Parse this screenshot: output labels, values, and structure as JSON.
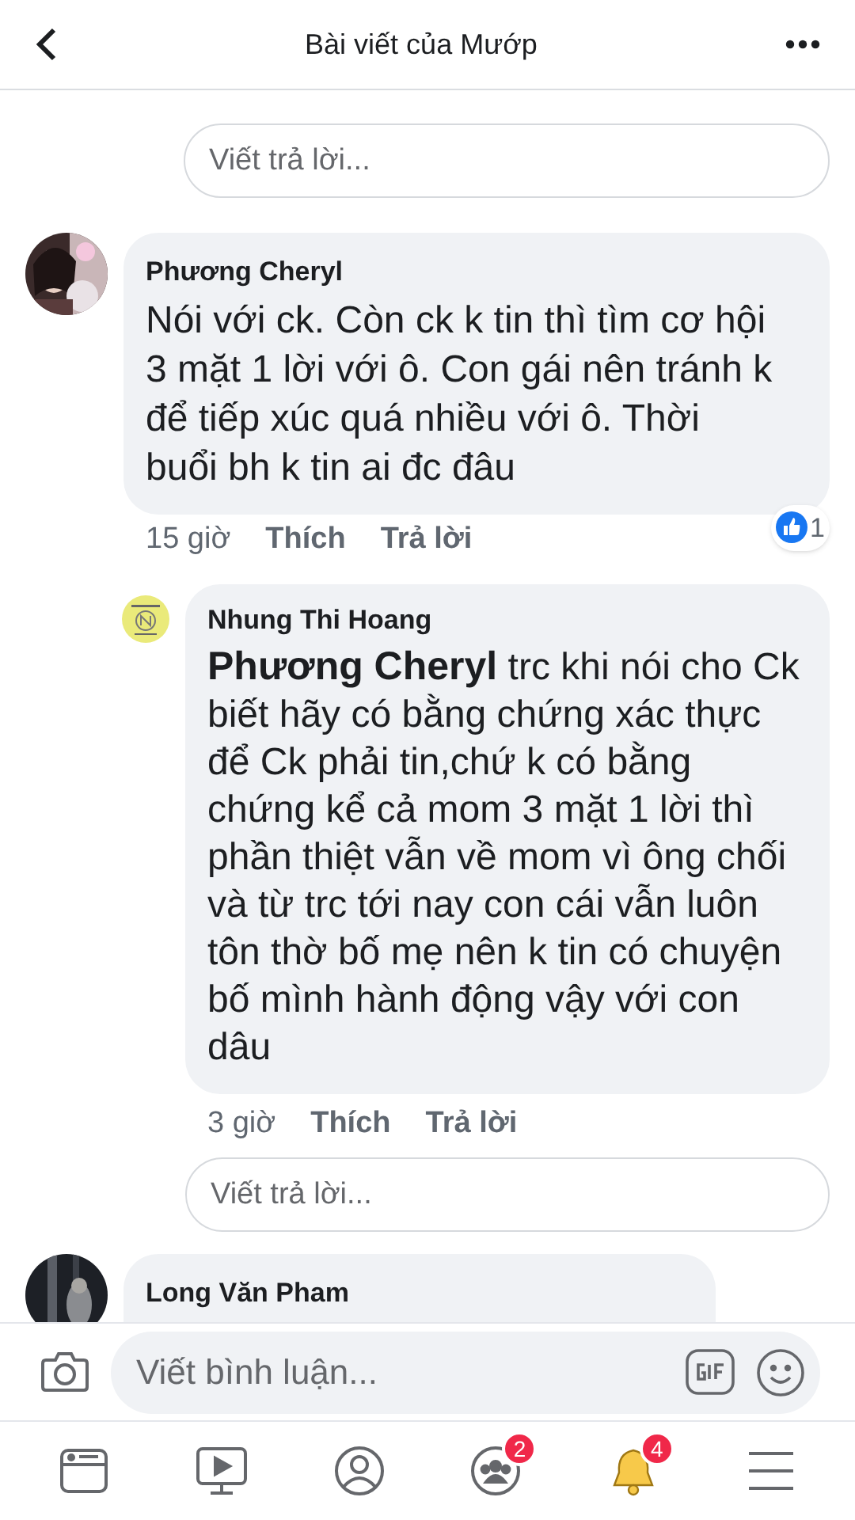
{
  "header": {
    "title": "Bài viết của Mướp"
  },
  "top_reply_field": {
    "placeholder": "Viết trả lời..."
  },
  "comments": [
    {
      "author": "Phương Cheryl",
      "text": "Nói với ck. Còn ck k tin thì tìm cơ hội 3 mặt 1 lời với ô. Con gái nên tránh k để tiếp xúc quá nhiều với ô. Thời buổi bh k tin ai đc đâu",
      "time": "15 giờ",
      "like": "Thích",
      "reply": "Trả lời",
      "reactions": "1",
      "avatar": {
        "kind": "picture"
      },
      "replies": [
        {
          "author": "Nhung Thi Hoang",
          "text": "**Phương Cheryl**  trc khi nói cho Ck biết hãy có bằng chứng xác thực để Ck phải tin,chứ k có bằng chứng kể cả mom 3 mặt 1 lời thì phần thiệt vẫn về mom vì ông chối và từ trc tới nay con cái vẫn luôn tôn thờ bố mẹ nên k tin có chuyện bố mình hành động vậy với con dâu",
          "time": "3 giờ",
          "like": "Thích",
          "reply": "Trả lời",
          "avatar": {
            "kind": "logo"
          }
        }
      ],
      "reply_field": {
        "placeholder": "Viết trả lời..."
      }
    },
    {
      "author": "Long Văn Pham",
      "avatar": {
        "kind": "picture"
      }
    }
  ],
  "composer": {
    "placeholder": "Viết bình luận..."
  },
  "nav": [
    {
      "kind": "feed"
    },
    {
      "kind": "watch"
    },
    {
      "kind": "profile"
    },
    {
      "kind": "groups",
      "badge": "2"
    },
    {
      "kind": "notifications",
      "badge": "4"
    },
    {
      "kind": "menu"
    }
  ]
}
